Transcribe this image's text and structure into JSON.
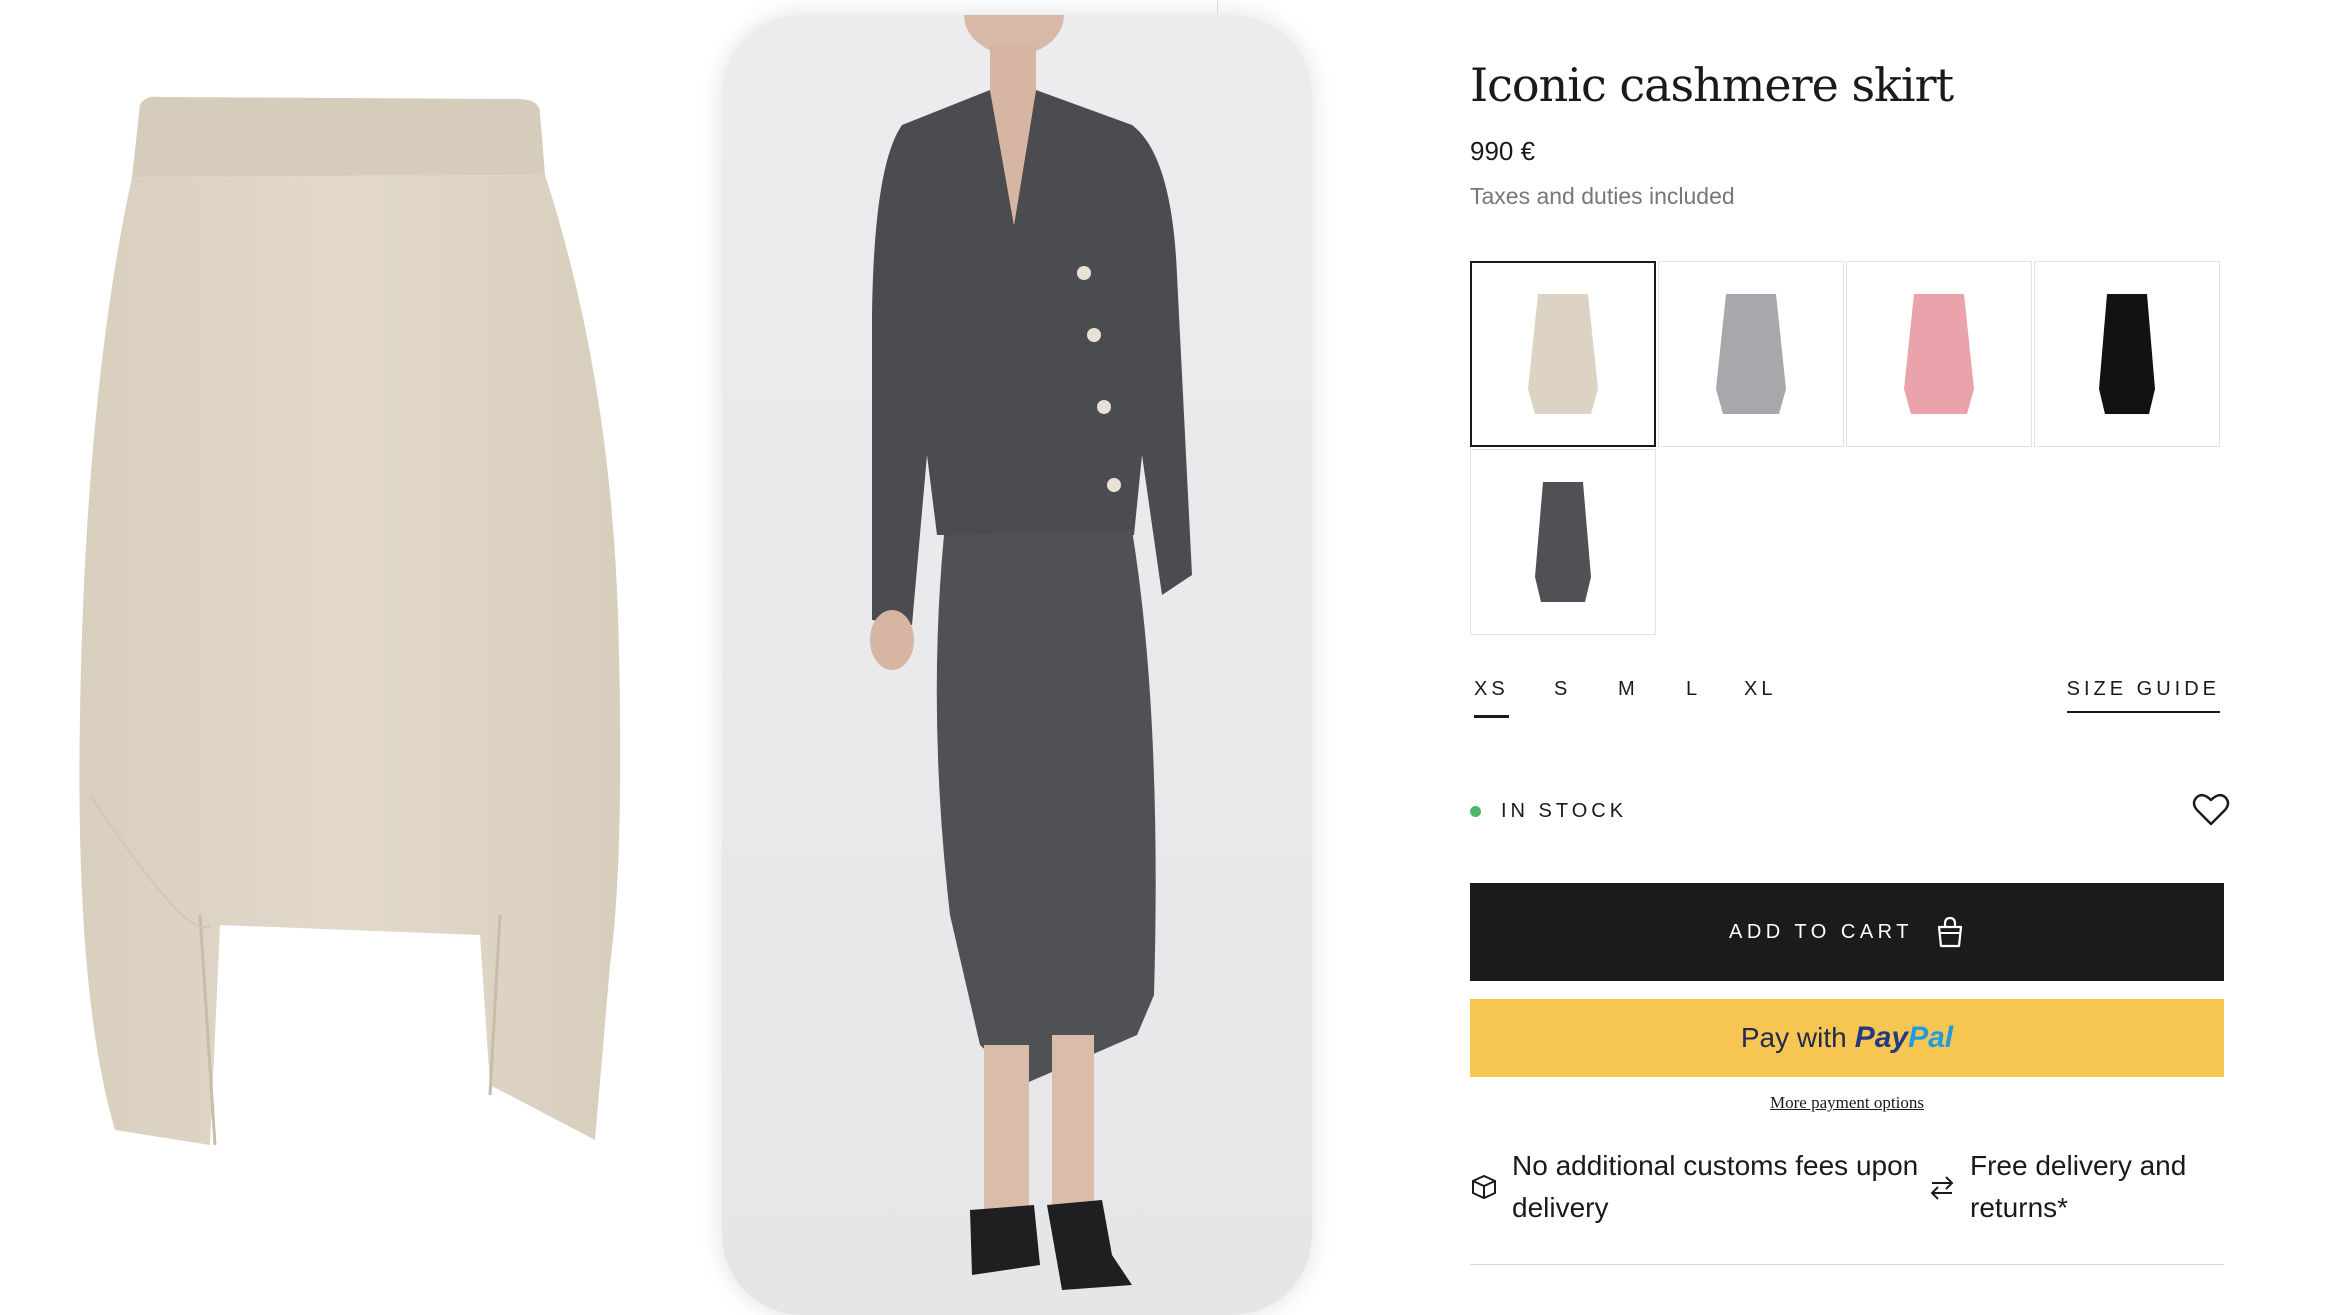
{
  "product": {
    "title": "Iconic cashmere skirt",
    "price": "990 €",
    "taxes_note": "Taxes and duties included"
  },
  "gallery": {
    "images": [
      {
        "name": "flat-skirt-beige",
        "color": "#ddd3c4"
      },
      {
        "name": "model-grey-outfit",
        "color": "#505052"
      }
    ]
  },
  "swatches": [
    {
      "name": "beige",
      "color": "#ddd3c4",
      "selected": true
    },
    {
      "name": "light-grey",
      "color": "#a6a8ab",
      "selected": false
    },
    {
      "name": "pink",
      "color": "#eaa3ab",
      "selected": false
    },
    {
      "name": "black",
      "color": "#121212",
      "selected": false
    },
    {
      "name": "dark-grey",
      "color": "#505154",
      "selected": false
    }
  ],
  "sizes": {
    "options": [
      "XS",
      "S",
      "M",
      "L",
      "XL"
    ],
    "selected": "XS",
    "guide_label": "SIZE GUIDE"
  },
  "stock": {
    "label": "IN STOCK",
    "color": "#4cb86a"
  },
  "actions": {
    "add_to_cart": "ADD TO CART",
    "paypal_prefix": "Pay with",
    "paypal_brand_pay": "Pay",
    "paypal_brand_pal": "Pal",
    "more_payment_options": "More payment options"
  },
  "info": {
    "customs": "No additional customs fees upon delivery",
    "delivery": "Free delivery and returns*"
  },
  "icons": {
    "wishlist": "heart-icon",
    "cart": "shopping-bag-icon",
    "customs": "package-icon",
    "delivery": "exchange-arrows-icon"
  }
}
